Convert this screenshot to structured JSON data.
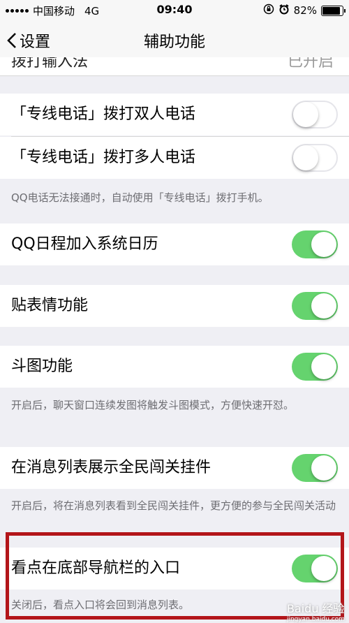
{
  "status_bar": {
    "carrier": "中国移动",
    "network": "4G",
    "time": "09:40",
    "battery": "82%",
    "battery_level": 0.82
  },
  "nav": {
    "back_label": "设置",
    "title": "辅助功能"
  },
  "partial_row": {
    "label": "拨打输入法",
    "value": "已开启"
  },
  "rows": [
    {
      "label": "「专线电话」拨打双人电话",
      "on": false
    },
    {
      "label": "「专线电话」拨打多人电话",
      "on": false
    },
    {
      "label": "QQ日程加入系统日历",
      "on": true
    },
    {
      "label": "贴表情功能",
      "on": true
    },
    {
      "label": "斗图功能",
      "on": true
    },
    {
      "label": "在消息列表展示全民闯关挂件",
      "on": true
    },
    {
      "label": "看点在底部导航栏的入口",
      "on": true
    }
  ],
  "notes": {
    "special_line": "QQ电话无法接通时，自动使用「专线电话」拨打手机。",
    "doutu": "开启后，聊天窗口连续发图将触发斗图模式，方便快速开怼。",
    "chuangguan": "开启后，将在消息列表看到全民闯关挂件，更方便的参与全民闯关活动",
    "kandian": "关闭后，看点入口将会回到消息列表。"
  },
  "watermark": {
    "brand": "Baidu 经验",
    "url": "jingyan.baidu.com"
  },
  "colors": {
    "toggle_on": "#65d36e",
    "highlight": "#b3151a"
  }
}
